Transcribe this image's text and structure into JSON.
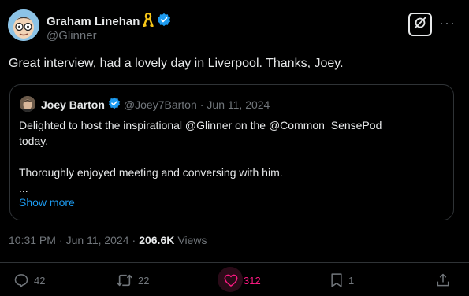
{
  "tweet": {
    "author": {
      "name": "Graham Linehan",
      "handle": "@Glinner",
      "verified_icon": "verified-badge-icon",
      "ribbon_icon": "yellow-ribbon-icon"
    },
    "text": "Great interview, had a lovely day in Liverpool. Thanks, Joey.",
    "quote": {
      "author_name": "Joey Barton",
      "author_handle": "@Joey7Barton",
      "separator": "·",
      "date": "Jun 11, 2024",
      "lines": [
        "Delighted to host the inspirational @Glinner on the @Common_SensePod",
        "today.",
        "",
        "Thoroughly enjoyed meeting and conversing with him.",
        "..."
      ],
      "show_more": "Show more"
    },
    "meta": {
      "time": "10:31 PM",
      "sep1": "·",
      "date": "Jun 11, 2024",
      "sep2": "·",
      "views": "206.6K",
      "views_label": "Views"
    },
    "actions": {
      "replies": "42",
      "reposts": "22",
      "likes": "312",
      "bookmarks": "1"
    }
  },
  "colors": {
    "background": "#000000",
    "text": "#e7e9ea",
    "muted": "#71767b",
    "link": "#1d9bf0",
    "like": "#f91880",
    "border": "#2f3336",
    "verified": "#1d9bf0",
    "ribbon": "#f5c518"
  }
}
